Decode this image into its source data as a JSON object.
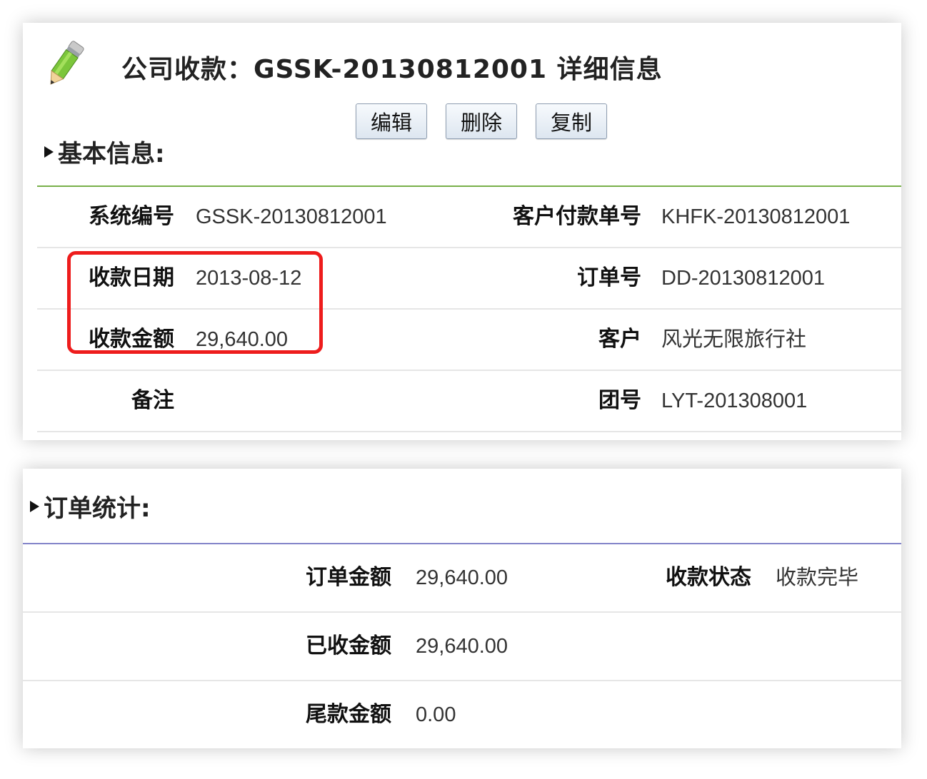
{
  "header": {
    "title": "公司收款：GSSK-20130812001 详细信息",
    "icon": "pencil-icon"
  },
  "toolbar": {
    "edit_label": "编辑",
    "delete_label": "删除",
    "copy_label": "复制"
  },
  "basic_info": {
    "section_title": "基本信息:",
    "fields": {
      "system_no_label": "系统编号",
      "system_no_value": "GSSK-20130812001",
      "customer_payment_no_label": "客户付款单号",
      "customer_payment_no_value": "KHFK-20130812001",
      "receipt_date_label": "收款日期",
      "receipt_date_value": "2013-08-12",
      "order_no_label": "订单号",
      "order_no_value": "DD-20130812001",
      "receipt_amount_label": "收款金额",
      "receipt_amount_value": "29,640.00",
      "customer_label": "客户",
      "customer_value": "风光无限旅行社",
      "remark_label": "备注",
      "remark_value": "",
      "group_no_label": "团号",
      "group_no_value": "LYT-201308001"
    },
    "highlight_color": "#ee1c1c"
  },
  "order_stats": {
    "section_title": "订单统计:",
    "fields": {
      "order_amount_label": "订单金额",
      "order_amount_value": "29,640.00",
      "receipt_status_label": "收款状态",
      "receipt_status_value": "收款完毕",
      "received_amount_label": "已收金额",
      "received_amount_value": "29,640.00",
      "balance_amount_label": "尾款金额",
      "balance_amount_value": "0.00"
    }
  },
  "colors": {
    "basic_divider": "#78b04a",
    "order_divider": "#8384c9"
  }
}
